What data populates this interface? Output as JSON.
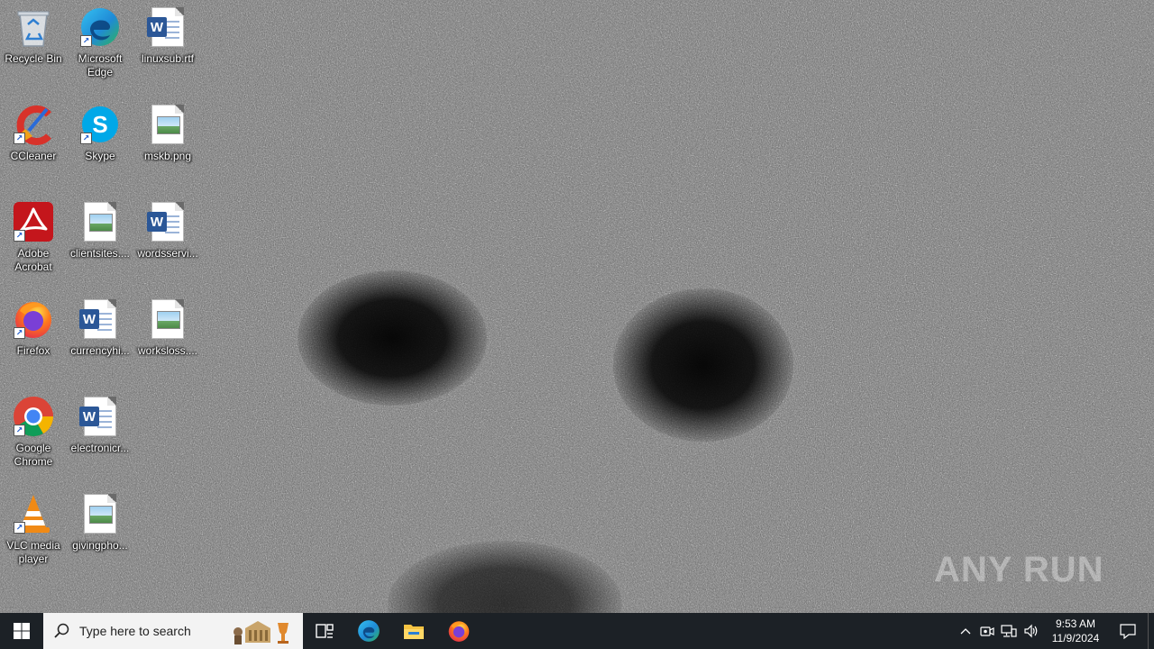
{
  "desktop": {
    "icons": [
      {
        "label": "Recycle Bin",
        "icon": "recycle-bin-icon"
      },
      {
        "label": "Microsoft Edge",
        "icon": "edge-icon"
      },
      {
        "label": "linuxsub.rtf",
        "icon": "word-document-icon"
      },
      {
        "label": "CCleaner",
        "icon": "ccleaner-icon"
      },
      {
        "label": "Skype",
        "icon": "skype-icon"
      },
      {
        "label": "mskb.png",
        "icon": "image-file-icon"
      },
      {
        "label": "Adobe Acrobat",
        "icon": "acrobat-icon"
      },
      {
        "label": "clientsites....",
        "icon": "image-file-icon"
      },
      {
        "label": "wordsservi...",
        "icon": "word-document-icon"
      },
      {
        "label": "Firefox",
        "icon": "firefox-icon"
      },
      {
        "label": "currencyhi...",
        "icon": "word-document-icon"
      },
      {
        "label": "worksloss....",
        "icon": "image-file-icon"
      },
      {
        "label": "Google Chrome",
        "icon": "chrome-icon"
      },
      {
        "label": "electronicr...",
        "icon": "word-document-icon"
      },
      {
        "label": "VLC media player",
        "icon": "vlc-icon"
      },
      {
        "label": "givingpho...",
        "icon": "image-file-icon"
      }
    ],
    "watermark": "ANY RUN"
  },
  "taskbar": {
    "search_placeholder": "Type here to search",
    "pinned": [
      "task-view-icon",
      "edge-icon",
      "file-explorer-icon",
      "firefox-icon"
    ],
    "clock": {
      "time": "9:53 AM",
      "date": "11/9/2024"
    }
  },
  "colors": {
    "taskbar": "#1c2126",
    "search_box": "#f3f3f3",
    "windows_blue": "#0078d7"
  }
}
